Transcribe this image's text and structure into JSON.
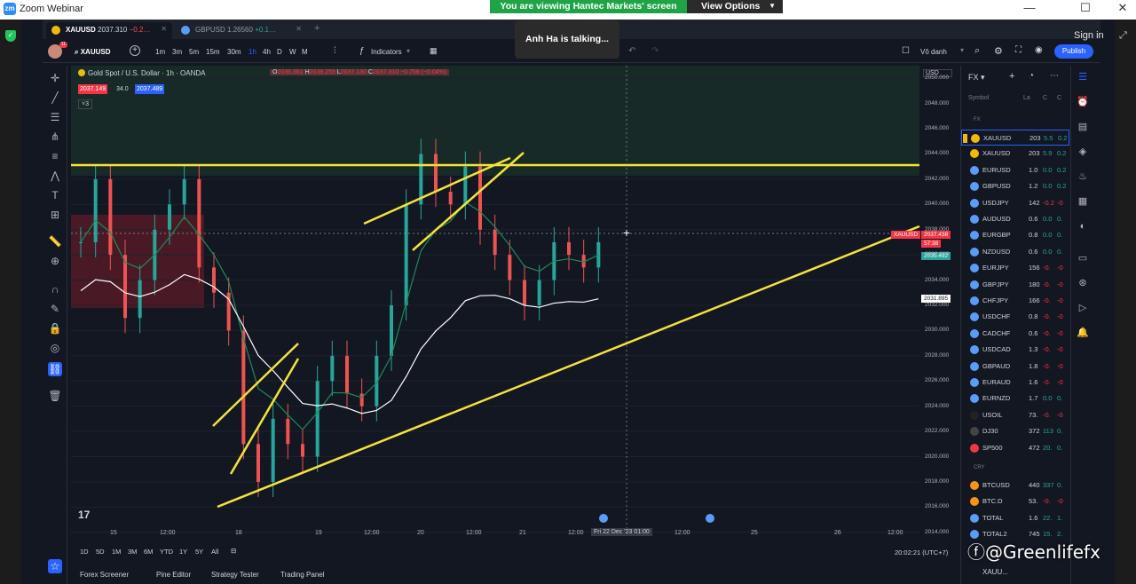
{
  "zoom": {
    "title": "Zoom Webinar",
    "logo": "zm",
    "share_banner": "You are viewing Hantec Markets' screen",
    "view_options": "View Options",
    "talking": "Anh Ha is talking...",
    "sign_in": "Sign in"
  },
  "tabs": [
    {
      "symbol": "XAUUSD",
      "price": "2037.310",
      "change": "−0.2…"
    },
    {
      "symbol": "GBPUSD",
      "price": "1.26560",
      "change": "+0.1…"
    }
  ],
  "toolbar": {
    "symbol": "XAUUSD",
    "avatar_badge": "11",
    "timeframes": [
      "1m",
      "3m",
      "5m",
      "15m",
      "30m",
      "1h",
      "4h",
      "D",
      "W",
      "M"
    ],
    "active_timeframe": "1h",
    "indicators": "Indicators",
    "layout_name": "Vô danh",
    "publish": "Publish"
  },
  "chart": {
    "title": "Gold Spot / U.S. Dollar · 1h · OANDA",
    "ohlc": {
      "o": "2036.361",
      "h": "2038.255",
      "l": "2037.130",
      "c": "2037.310",
      "chg": "−0.758 (−0.04%)"
    },
    "bid": "2037.149",
    "spread": "34.0",
    "ask": "2037.489",
    "collapsed_count": "3",
    "currency": "USD",
    "symbol_tag": "XAUUSD",
    "last_price": "2037.438",
    "countdown": "57:38",
    "green_tag": "2035.492",
    "cross_price": "2031.895",
    "crosshair_time": "Fri 22 Dec '23",
    "crosshair_hour": "01:00",
    "clock": "20:02:21 (UTC+7)",
    "logo": "17"
  },
  "chart_data": {
    "type": "candlestick",
    "title": "Gold Spot / U.S. Dollar · 1h · OANDA",
    "xlabel": "",
    "ylabel": "USD",
    "ylim": [
      2013,
      2051
    ],
    "x_ticks": [
      "15",
      "12:00",
      "18",
      "19",
      "12:00",
      "20",
      "12:00",
      "21",
      "12:00",
      "Fri 22 Dec '23",
      "12:00",
      "25",
      "26",
      "12:00"
    ],
    "y_ticks": [
      2050,
      2048,
      2046,
      2044,
      2042,
      2040,
      2038,
      2036,
      2034,
      2032,
      2030,
      2028,
      2026,
      2024,
      2022,
      2020,
      2018,
      2016,
      2014
    ],
    "closes": [
      2037,
      2042,
      2036,
      2031,
      2034,
      2038,
      2040,
      2042,
      2035,
      2033,
      2030,
      2021,
      2018,
      2023,
      2021,
      2020,
      2026,
      2028,
      2025,
      2024,
      2028,
      2032,
      2040,
      2044,
      2041,
      2040,
      2043,
      2038,
      2036,
      2034,
      2032,
      2034,
      2037,
      2036,
      2035,
      2037
    ],
    "horizontal_level": 2043.6
  },
  "bottom": {
    "ranges": [
      "1D",
      "5D",
      "1M",
      "3M",
      "6M",
      "YTD",
      "1Y",
      "5Y",
      "All"
    ],
    "panels": [
      "Forex Screener",
      "Pine Editor",
      "Strategy Tester",
      "Trading Panel"
    ]
  },
  "watchlist": {
    "title": "FX",
    "col_symbol": "Symbol",
    "col_last": "La",
    "col_chg": "C",
    "col_pct": "C",
    "section_fx": "FX",
    "section_cry": "CRY",
    "rows": [
      {
        "s": "XAUUSD",
        "l": "203",
        "c": "5.5",
        "p": "0.2",
        "color": "#f0b90b"
      },
      {
        "s": "XAUUSD",
        "l": "203",
        "c": "5.9",
        "p": "0.2",
        "color": "#f0b90b"
      },
      {
        "s": "EURUSD",
        "l": "1.0",
        "c": "0.0",
        "p": "0.2",
        "color": "#5b9cf6"
      },
      {
        "s": "GBPUSD",
        "l": "1.2",
        "c": "0.0",
        "p": "0.2",
        "color": "#5b9cf6"
      },
      {
        "s": "USDJPY",
        "l": "142",
        "c": "-0.2",
        "p": "-0",
        "color": "#5b9cf6"
      },
      {
        "s": "AUDUSD",
        "l": "0.6",
        "c": "0.0",
        "p": "0.",
        "color": "#5b9cf6"
      },
      {
        "s": "EURGBP",
        "l": "0.8",
        "c": "0.0",
        "p": "0.",
        "color": "#5b9cf6"
      },
      {
        "s": "NZDUSD",
        "l": "0.6",
        "c": "0.0",
        "p": "0.",
        "color": "#5b9cf6"
      },
      {
        "s": "EURJPY",
        "l": "156",
        "c": "-0.",
        "p": "-0",
        "color": "#5b9cf6"
      },
      {
        "s": "GBPJPY",
        "l": "180",
        "c": "-0.",
        "p": "-0",
        "color": "#5b9cf6"
      },
      {
        "s": "CHFJPY",
        "l": "166",
        "c": "-0.",
        "p": "-0",
        "color": "#5b9cf6"
      },
      {
        "s": "USDCHF",
        "l": "0.8",
        "c": "-0.",
        "p": "-0",
        "color": "#5b9cf6"
      },
      {
        "s": "CADCHF",
        "l": "0.6",
        "c": "-0.",
        "p": "-0",
        "color": "#5b9cf6"
      },
      {
        "s": "USDCAD",
        "l": "1.3",
        "c": "-0.",
        "p": "-0",
        "color": "#5b9cf6"
      },
      {
        "s": "GBPAUD",
        "l": "1.8",
        "c": "-0.",
        "p": "-0",
        "color": "#5b9cf6"
      },
      {
        "s": "EURAUD",
        "l": "1.6",
        "c": "-0.",
        "p": "-0",
        "color": "#5b9cf6"
      },
      {
        "s": "EURNZD",
        "l": "1.7",
        "c": "0.0",
        "p": "0.",
        "color": "#5b9cf6"
      },
      {
        "s": "USOIL",
        "l": "73.",
        "c": "-0.",
        "p": "-0",
        "color": "#222"
      },
      {
        "s": "DJ30",
        "l": "372",
        "c": "113",
        "p": "0.",
        "color": "#444"
      },
      {
        "s": "SP500",
        "l": "472",
        "c": "20.",
        "p": "0.",
        "color": "#f23645"
      }
    ],
    "crypto_rows": [
      {
        "s": "BTCUSD",
        "l": "440",
        "c": "337",
        "p": "0.",
        "color": "#f7931a"
      },
      {
        "s": "BTC.D",
        "l": "53.",
        "c": "-0.",
        "p": "-0",
        "color": "#f7931a"
      },
      {
        "s": "TOTAL",
        "l": "1.6",
        "c": "22.",
        "p": "1.",
        "color": "#5b9cf6"
      },
      {
        "s": "TOTAL2",
        "l": "745",
        "c": "15.",
        "p": "2.",
        "color": "#5b9cf6"
      }
    ],
    "footer": "XAUU..."
  },
  "watermark": "@Greenlifefx"
}
